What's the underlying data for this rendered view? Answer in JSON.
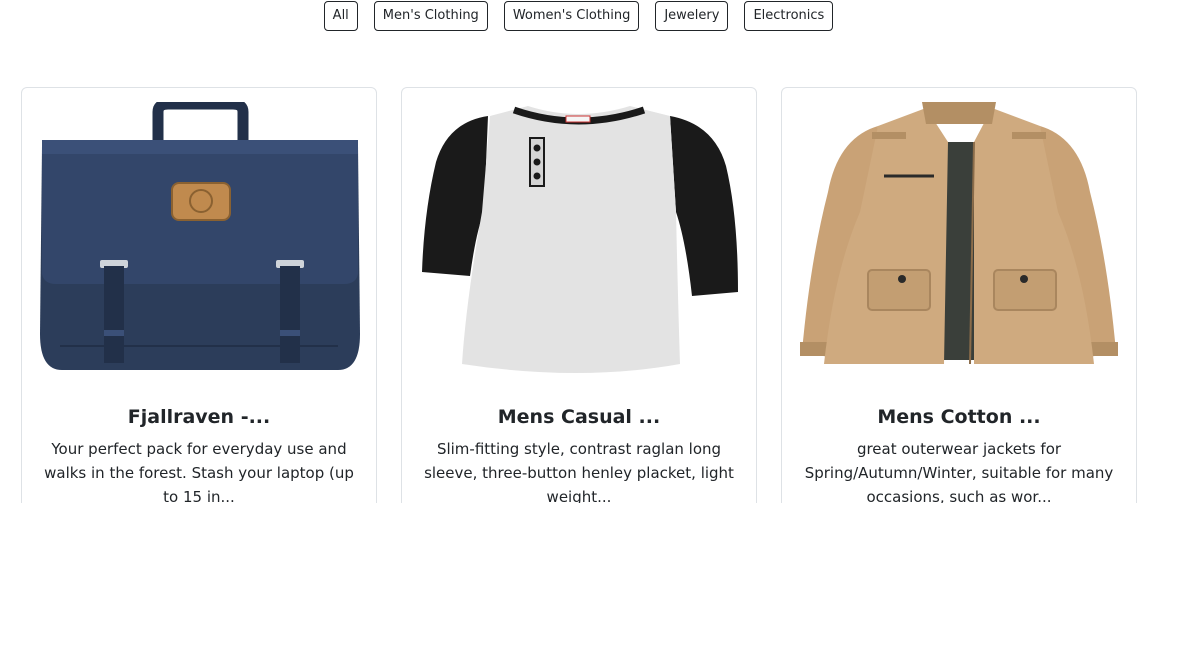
{
  "filters": [
    "All",
    "Men's Clothing",
    "Women's Clothing",
    "Jewelery",
    "Electronics"
  ],
  "products": [
    {
      "title": "Fjallraven -...",
      "description": "Your perfect pack for everyday use and walks in the forest. Stash your laptop (up to 15 in...",
      "image": "navy-backpack"
    },
    {
      "title": "Mens Casual ...",
      "description": "Slim-fitting style, contrast raglan long sleeve, three-button henley placket, light weight...",
      "image": "raglan-henley-shirt"
    },
    {
      "title": "Mens Cotton ...",
      "description": "great outerwear jackets for Spring/Autumn/Winter, suitable for many occasions, such as wor...",
      "image": "khaki-cotton-jacket"
    }
  ],
  "colors": {
    "backpack": "#2c3d5a",
    "backpack_dark": "#223049",
    "patch": "#c08a4e",
    "shirt_body": "#e3e3e3",
    "shirt_sleeve": "#1a1a1a",
    "jacket": "#cfaa7f",
    "jacket_dark": "#a9865e",
    "jacket_lining": "#3a3f3a"
  }
}
